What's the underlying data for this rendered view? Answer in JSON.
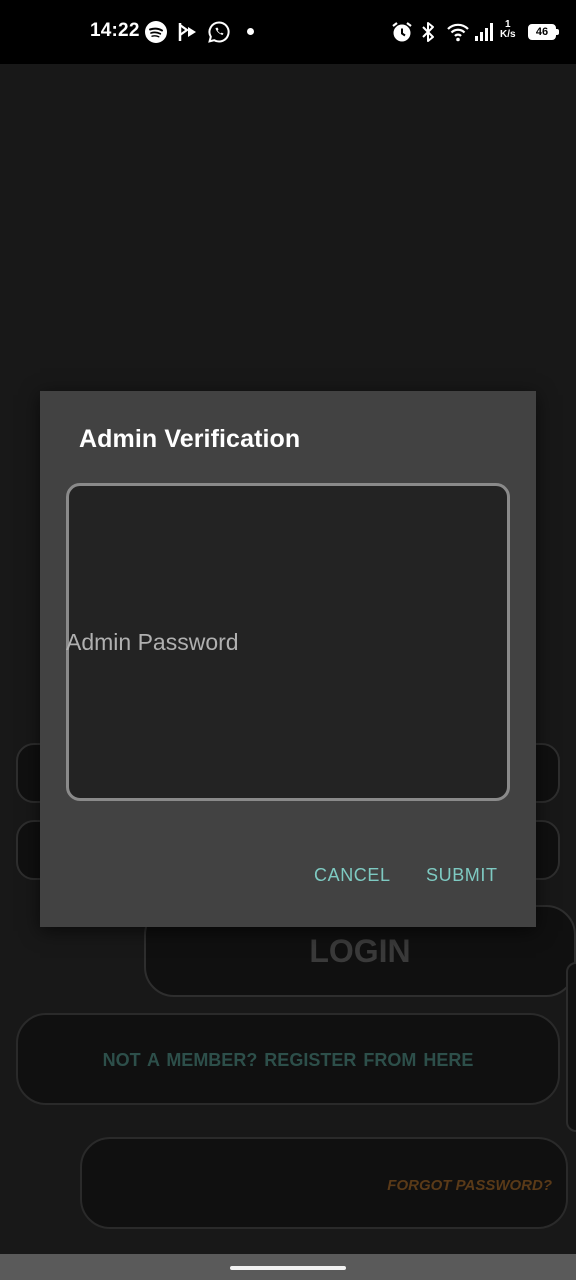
{
  "status_bar": {
    "time": "14:22",
    "icons": [
      "spotify-icon",
      "bixby-icon",
      "whatsapp-icon",
      "alarm-icon",
      "bluetooth-icon",
      "wifi-icon",
      "signal-icon"
    ],
    "net_speed_value": "1",
    "net_speed_unit": "K/s",
    "battery": "46"
  },
  "background": {
    "login_label": "LOGIN",
    "register_label": "NOT A MEMBER?  REGISTER FROM HERE",
    "forgot_label": "FORGOT PASSWORD?"
  },
  "dialog": {
    "title": "Admin Verification",
    "password_placeholder": "Admin Password",
    "password_value": "",
    "cancel_label": "CANCEL",
    "submit_label": "SUBMIT"
  },
  "colors": {
    "accent": "#7ecac2",
    "dialog_bg": "#424242",
    "screen_bg": "#181818"
  }
}
